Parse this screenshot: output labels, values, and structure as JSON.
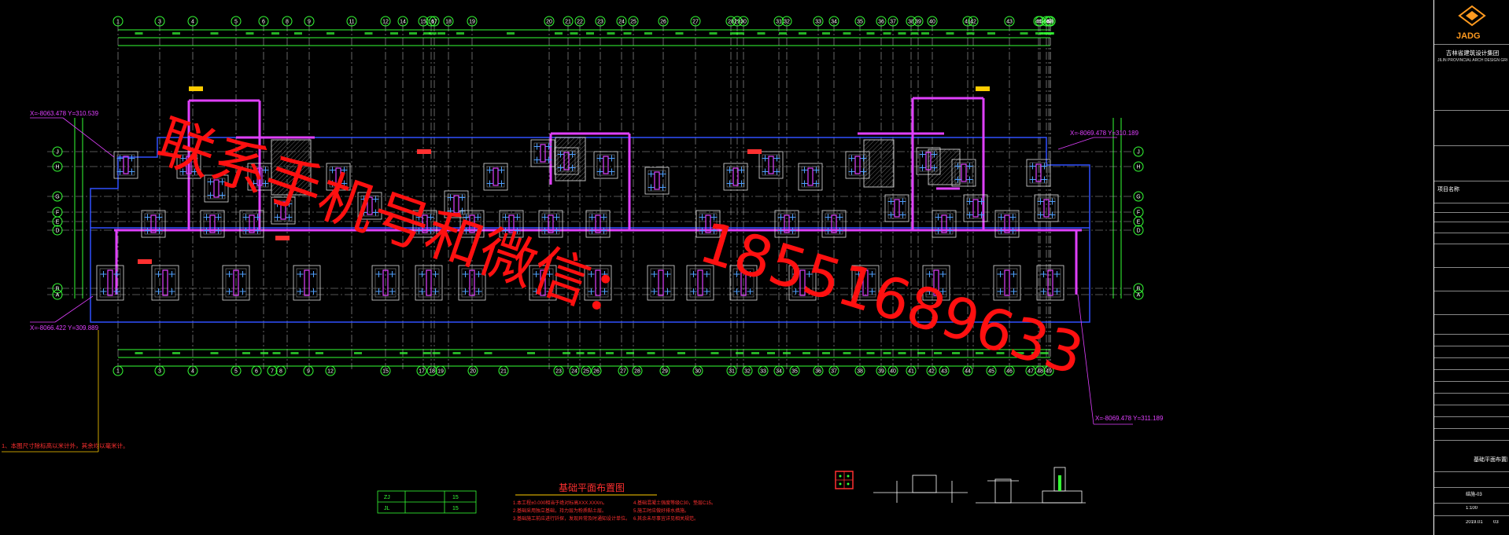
{
  "drawing": {
    "title": "基础平面布置图",
    "top_axes": [
      "1",
      "3",
      "4",
      "5",
      "6",
      "8",
      "9",
      "11",
      "12",
      "14",
      "15",
      "16",
      "17",
      "18",
      "19",
      "20",
      "21",
      "22",
      "23",
      "24",
      "25",
      "26",
      "27",
      "28",
      "29",
      "30",
      "31",
      "32",
      "33",
      "34",
      "35",
      "36",
      "37",
      "38",
      "39",
      "40",
      "41",
      "42",
      "43",
      "44",
      "45",
      "46",
      "47",
      "48",
      "49"
    ],
    "bottom_axes": [
      "1",
      "3",
      "4",
      "5",
      "6",
      "7",
      "8",
      "9",
      "12",
      "15",
      "17",
      "18",
      "19",
      "20",
      "21",
      "23",
      "24",
      "25",
      "26",
      "27",
      "28",
      "29",
      "30",
      "31",
      "32",
      "33",
      "34",
      "35",
      "36",
      "37",
      "38",
      "39",
      "40",
      "41",
      "42",
      "43",
      "44",
      "45",
      "46",
      "47",
      "48",
      "49"
    ],
    "side_axes": [
      "J",
      "H",
      "G",
      "F",
      "E",
      "D",
      "B",
      "A"
    ],
    "coords": [
      "X=-8063.478\nY=310.539",
      "X=-8066.422\nY=309.889",
      "X=-8069.478\nY=310.189",
      "X=-8069.478\nY=311.189"
    ],
    "note_left": "1、本图尺寸除标高以米计外，其余均以毫米计。",
    "notes": [
      "1.本工程±0.000相当于绝对标高XXX.XXXm。",
      "2.基础采用独立基础，持力层为粉质黏土层。",
      "3.基础施工前应进行钎探，发现异常及时通知设计单位。",
      "4.基础混凝土强度等级C30，垫层C15。",
      "5.施工时应做好排水措施。",
      "6.其余未尽事宜详见相关规范。"
    ],
    "legend_rows": [
      "ZJ",
      "JL"
    ],
    "legend_values": [
      "15",
      "15"
    ]
  },
  "title_block": {
    "logo_text": "JADG",
    "company": "吉林省建筑设计集团",
    "company_en": "JILIN PROVINCIAL ARCH DESIGN GROUP",
    "project_label": "项目名称",
    "drawing_name": "基础平面布置图",
    "drawing_no": "结施-03",
    "date": "2019.01",
    "scale": "1:100",
    "sheet": "03"
  },
  "watermark": {
    "line1": "联系手机号和微信：",
    "line2": "18551689633"
  }
}
